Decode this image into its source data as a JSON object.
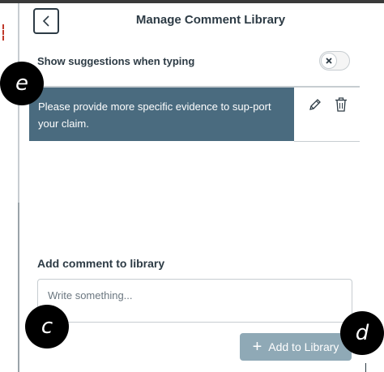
{
  "header": {
    "title": "Manage Comment Library"
  },
  "settings": {
    "suggestions_label": "Show suggestions when typing",
    "suggestions_enabled": false
  },
  "library": {
    "comments": [
      {
        "text": "Please provide more specific evidence to sup-port your claim."
      }
    ]
  },
  "add_section": {
    "label": "Add comment to library",
    "placeholder": "Write something...",
    "value": "",
    "button_label": "Add to Library"
  },
  "markers": {
    "e": "e",
    "c": "c",
    "d": "d"
  },
  "colors": {
    "comment_bg": "#4a6b7f",
    "button_disabled_bg": "#8fa9b6",
    "text_primary": "#2d3b45"
  },
  "icons": {
    "back": "chevron-left-icon",
    "toggle_off": "x-icon",
    "edit": "pencil-icon",
    "delete": "trash-icon",
    "add": "plus-icon"
  }
}
